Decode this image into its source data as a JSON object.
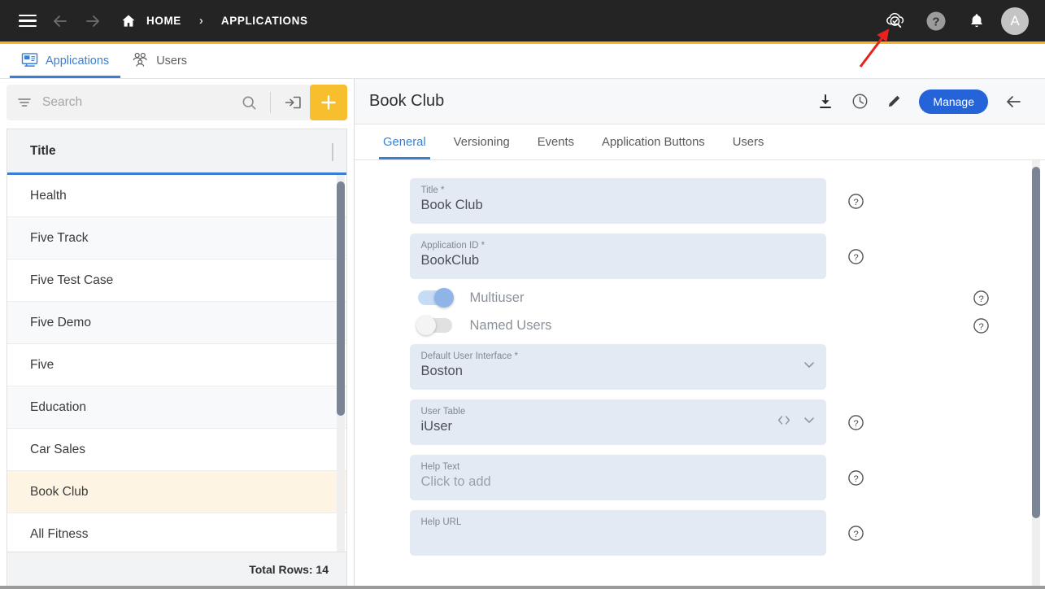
{
  "topbar": {
    "menu_icon": "hamburger-menu-icon",
    "back_icon": "arrow-left-icon",
    "forward_icon": "arrow-right-icon",
    "home_icon": "home-icon",
    "breadcrumb": [
      {
        "label": "HOME"
      },
      {
        "label": "APPLICATIONS"
      }
    ],
    "separator": "›",
    "right_icons": [
      {
        "name": "cloud-check-search-icon"
      },
      {
        "name": "help-circle-icon"
      },
      {
        "name": "notification-bell-icon"
      }
    ],
    "avatar_initial": "A",
    "accent_underline": "#f5b526",
    "background": "#242424"
  },
  "module_tabs": [
    {
      "label": "Applications",
      "icon": "monitor-application-icon",
      "active": true
    },
    {
      "label": "Users",
      "icon": "users-group-icon",
      "active": false
    }
  ],
  "left_panel": {
    "search": {
      "placeholder": "Search",
      "value": "",
      "filter_icon": "filter-icon",
      "search_icon": "search-icon",
      "import_icon": "import-arrow-into-box-icon",
      "add_icon": "plus-icon",
      "add_button_color": "#f7bf2e"
    },
    "grid": {
      "column_header": "Title",
      "selected_row": "Book Club",
      "rows": [
        {
          "title": "All Fitness"
        },
        {
          "title": "Book Club"
        },
        {
          "title": "Car Sales"
        },
        {
          "title": "Education"
        },
        {
          "title": "Five"
        },
        {
          "title": "Five Demo"
        },
        {
          "title": "Five Test Case"
        },
        {
          "title": "Five Track"
        },
        {
          "title": "Health"
        }
      ],
      "footer": "Total Rows: 14",
      "header_underline_color": "#3b7fd4",
      "selected_row_color": "#fdf4e3"
    }
  },
  "right_panel": {
    "record_title": "Book Club",
    "actions": [
      {
        "name": "download-icon"
      },
      {
        "name": "history-clock-icon"
      },
      {
        "name": "edit-pencil-icon"
      }
    ],
    "manage_button": "Manage",
    "manage_button_color": "#2563d9",
    "close_icon": "arrow-left-back-icon",
    "tabs": [
      {
        "label": "General",
        "active": true
      },
      {
        "label": "Versioning",
        "active": false
      },
      {
        "label": "Events",
        "active": false
      },
      {
        "label": "Application Buttons",
        "active": false
      },
      {
        "label": "Users",
        "active": false
      }
    ],
    "fields": [
      {
        "type": "text",
        "label": "Title *",
        "value": "Book Club",
        "placeholder": "",
        "help": true
      },
      {
        "type": "text",
        "label": "Application ID *",
        "value": "BookClub",
        "placeholder": "",
        "help": true
      },
      {
        "type": "toggle",
        "label": "Multiuser",
        "state": "on",
        "help": true
      },
      {
        "type": "toggle",
        "label": "Named Users",
        "state": "off",
        "help": true
      },
      {
        "type": "select",
        "label": "Default User Interface *",
        "value": "Boston",
        "help": false,
        "chevron": "chevron-down-icon"
      },
      {
        "type": "select",
        "label": "User Table",
        "value": "iUser",
        "help": true,
        "code_icon": "code-brackets-icon",
        "chevron": "chevron-down-icon"
      },
      {
        "type": "text",
        "label": "Help Text",
        "value": "Click to add",
        "is_placeholder_value": true,
        "help": true
      },
      {
        "type": "textarea",
        "label": "Help URL",
        "value": "",
        "help": true
      }
    ],
    "field_background": "#e3eaf3"
  },
  "annotation": {
    "type": "red-arrow",
    "color": "#e8211c",
    "points_to": "cloud-check-search-icon"
  }
}
